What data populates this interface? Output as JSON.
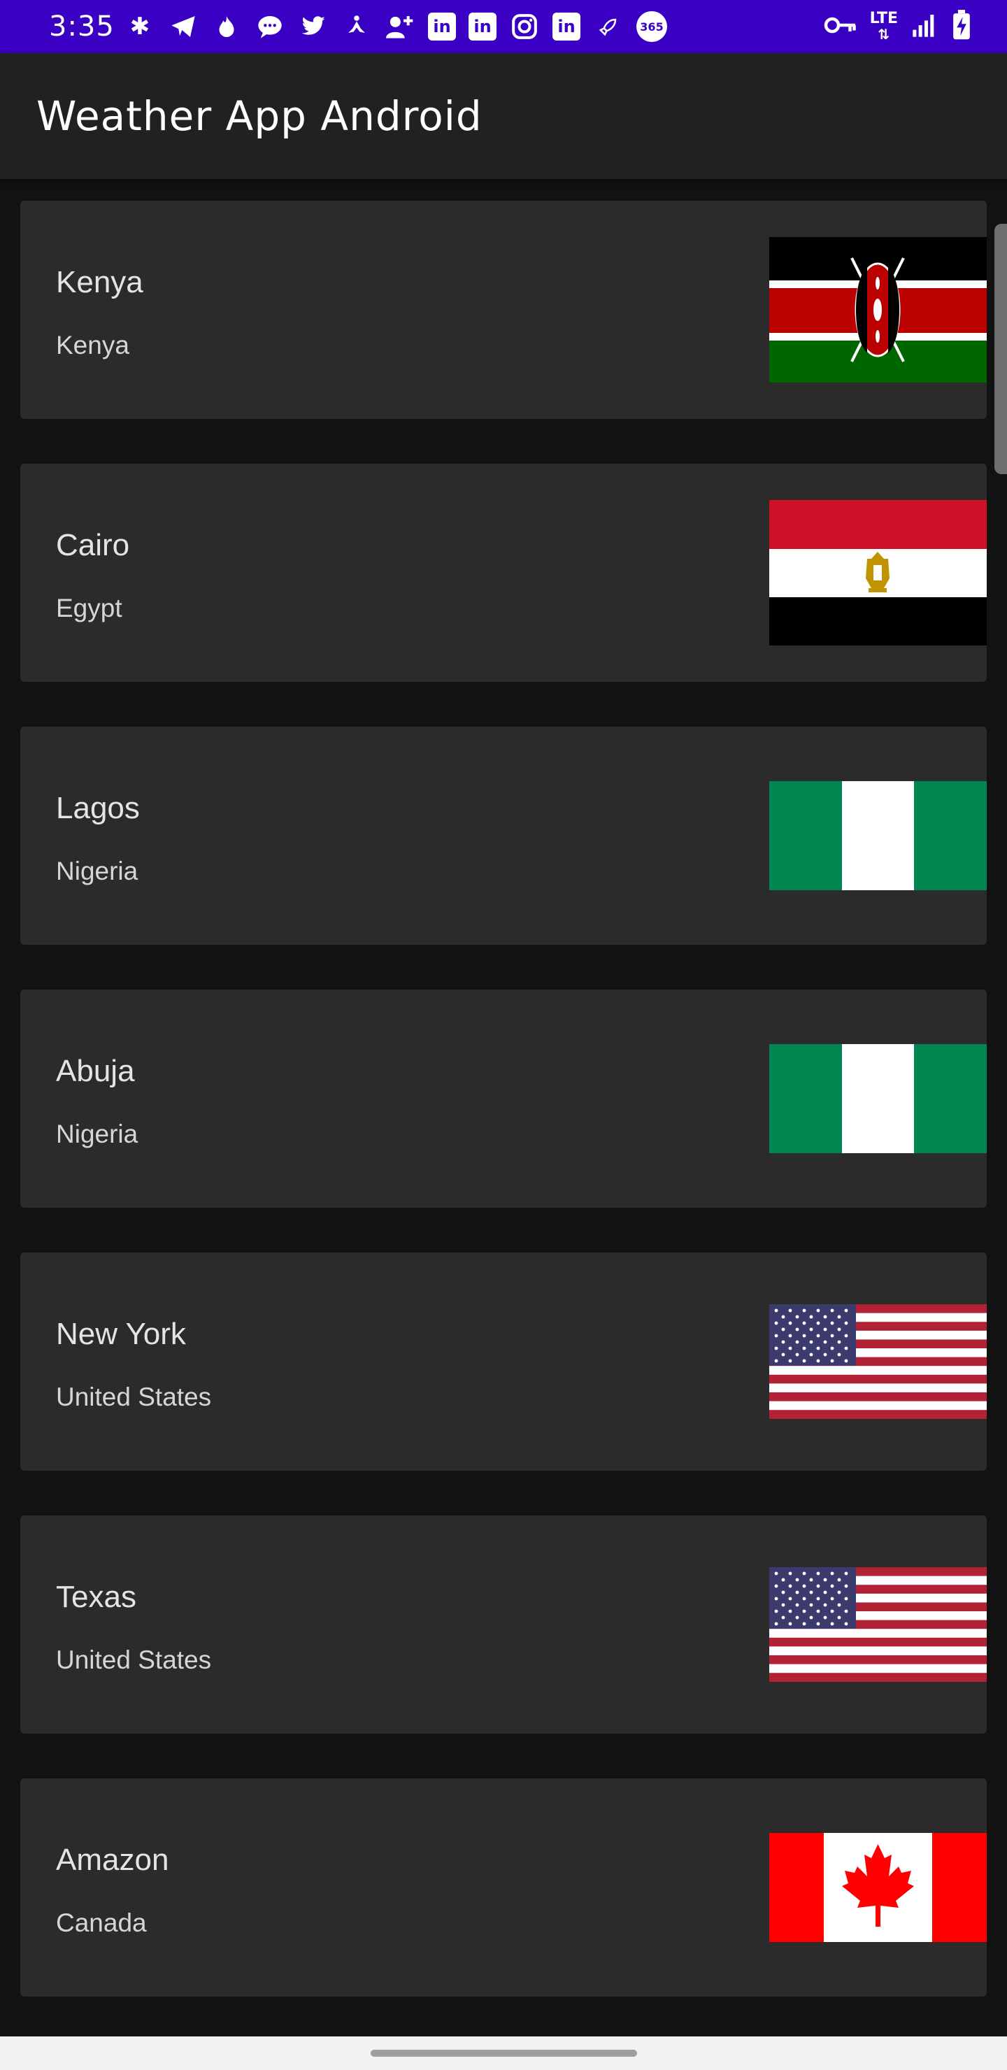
{
  "status_bar": {
    "time": "3:35",
    "network_label": "LTE",
    "notification_icons": [
      "slack-icon",
      "telegram-icon",
      "tinder-icon",
      "messages-icon",
      "twitter-icon",
      "yoga-icon",
      "add-contact-icon",
      "linkedin-icon",
      "linkedin-icon",
      "instagram-icon",
      "linkedin-icon",
      "rocket-icon",
      "app-365-icon"
    ],
    "system_icons": [
      "vpn-key-icon",
      "lte-icon",
      "signal-icon",
      "battery-charging-icon"
    ],
    "background_color": "#3a00c4"
  },
  "app_bar": {
    "title": "Weather App Android",
    "background_color": "#212121"
  },
  "locations": [
    {
      "city": "Kenya",
      "country": "Kenya",
      "flag": "kenya-flag"
    },
    {
      "city": "Cairo",
      "country": "Egypt",
      "flag": "egypt-flag"
    },
    {
      "city": "Lagos",
      "country": "Nigeria",
      "flag": "nigeria-flag"
    },
    {
      "city": "Abuja",
      "country": "Nigeria",
      "flag": "nigeria-flag"
    },
    {
      "city": "New York",
      "country": "United States",
      "flag": "usa-flag"
    },
    {
      "city": "Texas",
      "country": "United States",
      "flag": "usa-flag"
    },
    {
      "city": "Amazon",
      "country": "Canada",
      "flag": "canada-flag"
    }
  ],
  "colors": {
    "background": "#121212",
    "card": "#2b2b2b"
  }
}
